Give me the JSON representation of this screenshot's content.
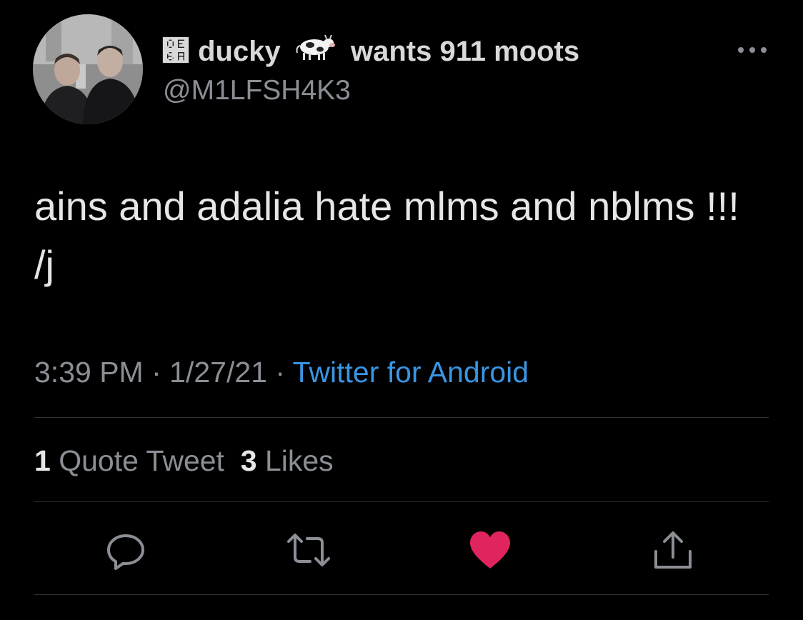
{
  "author": {
    "display_name_prefix": "๪ ducky",
    "display_name_suffix": "wants 911 moots",
    "handle": "@M1LFSH4K3"
  },
  "tweet": {
    "text": "ains and adalia hate mlms and nblms !!! /j",
    "time": "3:39 PM",
    "date": "1/27/21",
    "separator": " · ",
    "source": "Twitter for Android"
  },
  "stats": {
    "quote_count": "1",
    "quote_label": "Quote Tweet",
    "like_count": "3",
    "like_label": "Likes"
  },
  "icons": {
    "more": "more-options-icon",
    "emoji": "cow-emoji",
    "reply": "reply-icon",
    "retweet": "retweet-icon",
    "like": "heart-icon",
    "share": "share-icon"
  },
  "colors": {
    "background": "#000000",
    "text": "#e6e6e6",
    "secondary": "#8b8f95",
    "link": "#3a95e3",
    "like": "#e0245e",
    "divider": "#2f3336"
  }
}
